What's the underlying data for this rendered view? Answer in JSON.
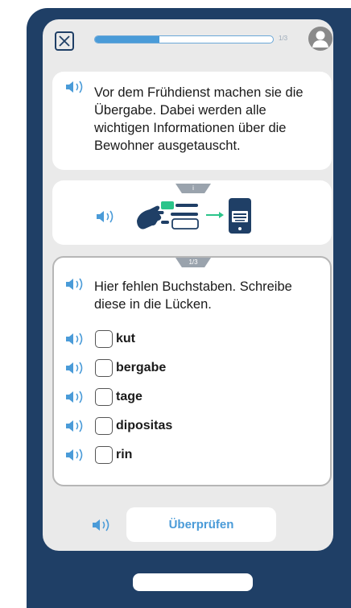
{
  "progress": {
    "label": "1/3",
    "value": 0.36
  },
  "intro": {
    "text": "Vor dem Frühdienst machen sie die Übergabe. Dabei werden alle wichtigen Informationen über die Bewohner ausgetauscht."
  },
  "info_tab": {
    "label": "i"
  },
  "task": {
    "tab_label": "1/3",
    "instruction": "Hier fehlen Buchstaben. Schreibe diese in die Lücken.",
    "items": [
      {
        "word": "kut"
      },
      {
        "word": "bergabe"
      },
      {
        "word": "tage"
      },
      {
        "word": "dipositas"
      },
      {
        "word": "rin"
      }
    ]
  },
  "check_button": {
    "label": "Überprüfen"
  },
  "colors": {
    "accent": "#4a9bd8",
    "frame": "#1f3f66",
    "green": "#2bc48a"
  },
  "icons": [
    "close-icon",
    "user-avatar-icon",
    "speaker-icon",
    "hand-pointing-icon",
    "arrow-right-icon",
    "tablet-keyboard-icon"
  ]
}
